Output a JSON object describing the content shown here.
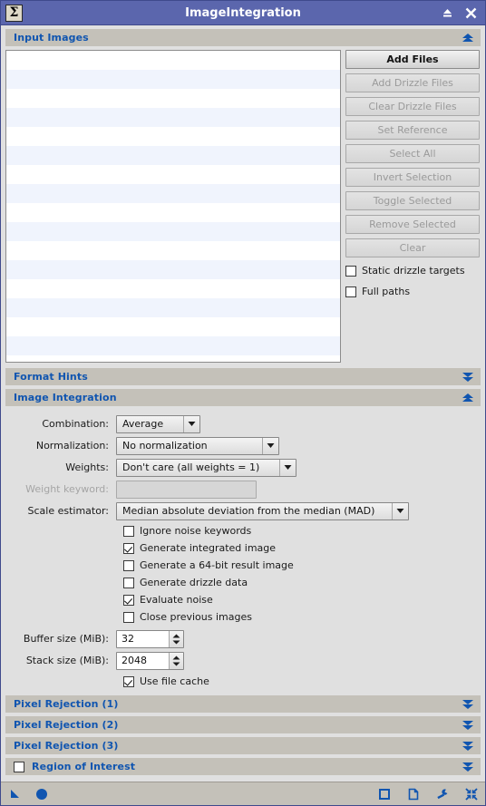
{
  "window": {
    "title": "ImageIntegration",
    "icon": "sigma-icon",
    "icon_glyph": "Σ",
    "accent_color": "#1055b0",
    "titlebar_color": "#5b66ad",
    "section_header_color": "#c4c1b9",
    "background_color": "#e0e0e0",
    "buttons": [
      {
        "name": "roll-up-button",
        "icon": "roll-up-icon"
      },
      {
        "name": "close-button",
        "icon": "close-icon"
      }
    ]
  },
  "sections": {
    "input_images": {
      "title": "Input Images",
      "state": "expanded",
      "toggle_icon": "chevron-double-up-icon"
    },
    "format_hints": {
      "title": "Format Hints",
      "state": "collapsed",
      "toggle_icon": "chevron-double-down-icon"
    },
    "image_integration": {
      "title": "Image Integration",
      "state": "expanded",
      "toggle_icon": "chevron-double-up-icon"
    },
    "pixel_rejection_1": {
      "title": "Pixel Rejection (1)",
      "state": "collapsed",
      "toggle_icon": "chevron-double-down-icon"
    },
    "pixel_rejection_2": {
      "title": "Pixel Rejection (2)",
      "state": "collapsed",
      "toggle_icon": "chevron-double-down-icon"
    },
    "pixel_rejection_3": {
      "title": "Pixel Rejection (3)",
      "state": "collapsed",
      "toggle_icon": "chevron-double-down-icon"
    },
    "region_of_interest": {
      "title": "Region of Interest",
      "state": "collapsed",
      "enabled": false,
      "toggle_icon": "chevron-double-down-icon"
    }
  },
  "input_images": {
    "file_list": {
      "items": [],
      "row_count": 16
    },
    "buttons": [
      {
        "label": "Add Files",
        "enabled": true
      },
      {
        "label": "Add Drizzle Files",
        "enabled": false
      },
      {
        "label": "Clear Drizzle Files",
        "enabled": false
      },
      {
        "label": "Set Reference",
        "enabled": false
      },
      {
        "label": "Select All",
        "enabled": false
      },
      {
        "label": "Invert Selection",
        "enabled": false
      },
      {
        "label": "Toggle Selected",
        "enabled": false
      },
      {
        "label": "Remove Selected",
        "enabled": false
      },
      {
        "label": "Clear",
        "enabled": false
      }
    ],
    "checkboxes": [
      {
        "label": "Static drizzle targets",
        "checked": false
      },
      {
        "label": "Full paths",
        "checked": false
      }
    ]
  },
  "image_integration": {
    "combination": {
      "label": "Combination:",
      "value": "Average",
      "enabled": true
    },
    "normalization": {
      "label": "Normalization:",
      "value": "No normalization",
      "enabled": true
    },
    "weights": {
      "label": "Weights:",
      "value": "Don't care (all weights = 1)",
      "enabled": true
    },
    "weight_keyword": {
      "label": "Weight keyword:",
      "value": "",
      "enabled": false
    },
    "scale_estimator": {
      "label": "Scale estimator:",
      "value": "Median absolute deviation from the median (MAD)",
      "enabled": true
    },
    "checkboxes": [
      {
        "label": "Ignore noise keywords",
        "checked": false
      },
      {
        "label": "Generate integrated image",
        "checked": true
      },
      {
        "label": "Generate a 64-bit result image",
        "checked": false
      },
      {
        "label": "Generate drizzle data",
        "checked": false
      },
      {
        "label": "Evaluate noise",
        "checked": true
      },
      {
        "label": "Close previous images",
        "checked": false
      }
    ],
    "buffer_size": {
      "label": "Buffer size (MiB):",
      "value": "32"
    },
    "stack_size": {
      "label": "Stack size (MiB):",
      "value": "2048"
    },
    "use_file_cache": {
      "label": "Use file cache",
      "checked": true
    }
  },
  "footer": {
    "left_icons": [
      {
        "name": "apply-triangle-icon"
      },
      {
        "name": "apply-global-circle-icon"
      }
    ],
    "right_icons": [
      {
        "name": "new-instance-square-icon"
      },
      {
        "name": "browse-documentation-page-icon"
      },
      {
        "name": "reset-wrench-icon"
      },
      {
        "name": "collapse-arrows-icon"
      }
    ]
  }
}
